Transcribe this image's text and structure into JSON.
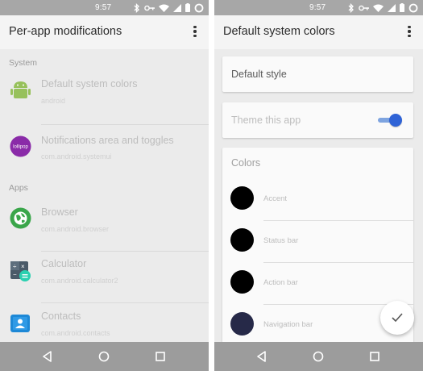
{
  "left": {
    "status_time": "9:57",
    "title": "Per-app modifications",
    "sections": {
      "system": "System",
      "apps": "Apps"
    },
    "items": [
      {
        "name": "Default system colors",
        "package": "android",
        "icon": "android-robot-icon"
      },
      {
        "name": "Notifications area and toggles",
        "package": "com.android.systemui",
        "icon": "lollipop-icon",
        "icon_text": "lollipop"
      },
      {
        "name": "Browser",
        "package": "com.android.browser",
        "icon": "browser-globe-icon"
      },
      {
        "name": "Calculator",
        "package": "com.android.calculator2",
        "icon": "calculator-icon"
      },
      {
        "name": "Contacts",
        "package": "com.android.contacts",
        "icon": "contacts-icon"
      }
    ]
  },
  "right": {
    "status_time": "9:57",
    "title": "Default system colors",
    "default_style_label": "Default style",
    "theme_label": "Theme this app",
    "theme_enabled": true,
    "colors_header": "Colors",
    "colors": [
      {
        "label": "Accent",
        "color": "#000000"
      },
      {
        "label": "Status bar",
        "color": "#000000"
      },
      {
        "label": "Action bar",
        "color": "#000000"
      },
      {
        "label": "Navigation bar",
        "color": "#262948"
      }
    ],
    "fab_icon": "check-icon"
  },
  "theme": {
    "statusbar": "#a7a7a7",
    "navbar": "#9c9c9c",
    "switch_on": "#2f63d6"
  }
}
